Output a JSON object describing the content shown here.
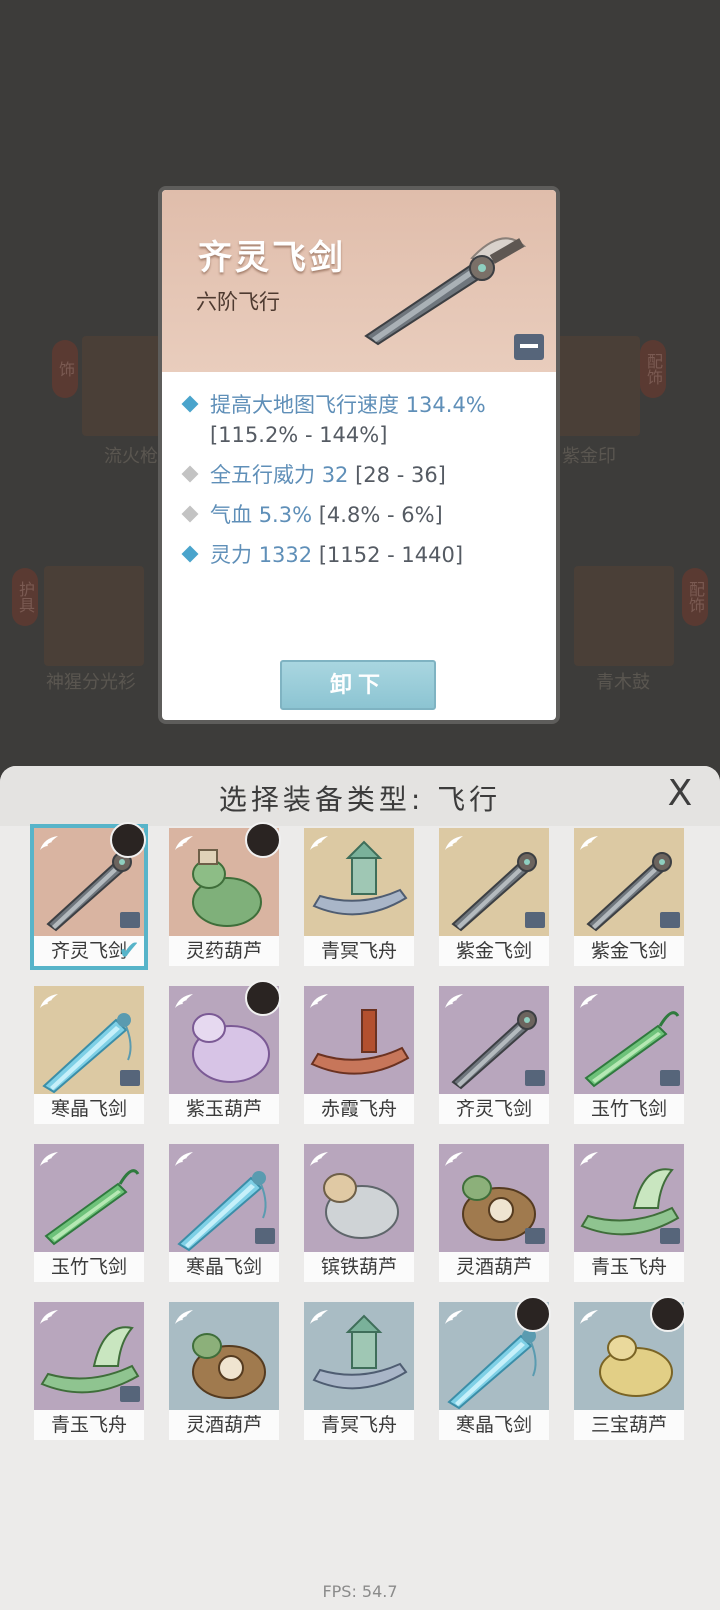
{
  "background": {
    "left_items": [
      {
        "badge": "饰",
        "label": "流火枪"
      },
      {
        "badge": "护具",
        "label": "神猩分光衫"
      }
    ],
    "right_items": [
      {
        "badge": "配饰",
        "label": "紫金印"
      },
      {
        "badge": "配饰",
        "label": "青木鼓"
      }
    ]
  },
  "detail": {
    "title": "齐灵飞剑",
    "subtitle": "六阶飞行",
    "stats": [
      {
        "type": "blue",
        "name": "提高大地图飞行速度",
        "value": "134.4%",
        "range": "[115.2% - 144%]"
      },
      {
        "type": "grey",
        "name": "全五行威力",
        "value": "32",
        "range": "[28 - 36]"
      },
      {
        "type": "grey",
        "name": "气血",
        "value": "5.3%",
        "range": "[4.8% - 6%]"
      },
      {
        "type": "blue",
        "name": "灵力",
        "value": "1332",
        "range": "[1152 - 1440]"
      }
    ],
    "unequip_label": "卸下"
  },
  "panel": {
    "title": "选择装备类型: 飞行",
    "close_label": "X"
  },
  "items": [
    {
      "label": "齐灵飞剑",
      "bg": "#d9b4a1",
      "kind": "sword",
      "avatar": true,
      "lock": true,
      "selected": true
    },
    {
      "label": "灵药葫芦",
      "bg": "#d9b4a1",
      "kind": "gourd",
      "avatar": true,
      "lock": false
    },
    {
      "label": "青冥飞舟",
      "bg": "#dcc9a3",
      "kind": "boat",
      "avatar": false,
      "lock": false
    },
    {
      "label": "紫金飞剑",
      "bg": "#dcc9a3",
      "kind": "sword",
      "avatar": false,
      "lock": true
    },
    {
      "label": "紫金飞剑",
      "bg": "#dcc9a3",
      "kind": "sword",
      "avatar": false,
      "lock": true
    },
    {
      "label": "寒晶飞剑",
      "bg": "#dcc9a3",
      "kind": "sword-blue",
      "avatar": false,
      "lock": true
    },
    {
      "label": "紫玉葫芦",
      "bg": "#b8a6bd",
      "kind": "gourd-purple",
      "avatar": true,
      "lock": false
    },
    {
      "label": "赤霞飞舟",
      "bg": "#b8a6bd",
      "kind": "boat-red",
      "avatar": false,
      "lock": false
    },
    {
      "label": "齐灵飞剑",
      "bg": "#b8a6bd",
      "kind": "sword",
      "avatar": false,
      "lock": true
    },
    {
      "label": "玉竹飞剑",
      "bg": "#b8a6bd",
      "kind": "sword-green",
      "avatar": false,
      "lock": true
    },
    {
      "label": "玉竹飞剑",
      "bg": "#b8a6bd",
      "kind": "sword-green",
      "avatar": false,
      "lock": false
    },
    {
      "label": "寒晶飞剑",
      "bg": "#b8a6bd",
      "kind": "sword-blue",
      "avatar": false,
      "lock": true
    },
    {
      "label": "镔铁葫芦",
      "bg": "#b8a6bd",
      "kind": "gourd-grey",
      "avatar": false,
      "lock": false
    },
    {
      "label": "灵酒葫芦",
      "bg": "#b8a6bd",
      "kind": "gourd-brown",
      "avatar": false,
      "lock": true
    },
    {
      "label": "青玉飞舟",
      "bg": "#b8a6bd",
      "kind": "boat-green",
      "avatar": false,
      "lock": true
    },
    {
      "label": "青玉飞舟",
      "bg": "#b8a6bd",
      "kind": "boat-green",
      "avatar": false,
      "lock": true
    },
    {
      "label": "灵酒葫芦",
      "bg": "#a9bcc4",
      "kind": "gourd-brown",
      "avatar": false,
      "lock": false
    },
    {
      "label": "青冥飞舟",
      "bg": "#a9bcc4",
      "kind": "boat",
      "avatar": false,
      "lock": false
    },
    {
      "label": "寒晶飞剑",
      "bg": "#a9bcc4",
      "kind": "sword-blue",
      "avatar": true,
      "lock": false
    },
    {
      "label": "三宝葫芦",
      "bg": "#a9bcc4",
      "kind": "gourd-gold",
      "avatar": true,
      "lock": false
    }
  ],
  "fps": "FPS: 54.7"
}
